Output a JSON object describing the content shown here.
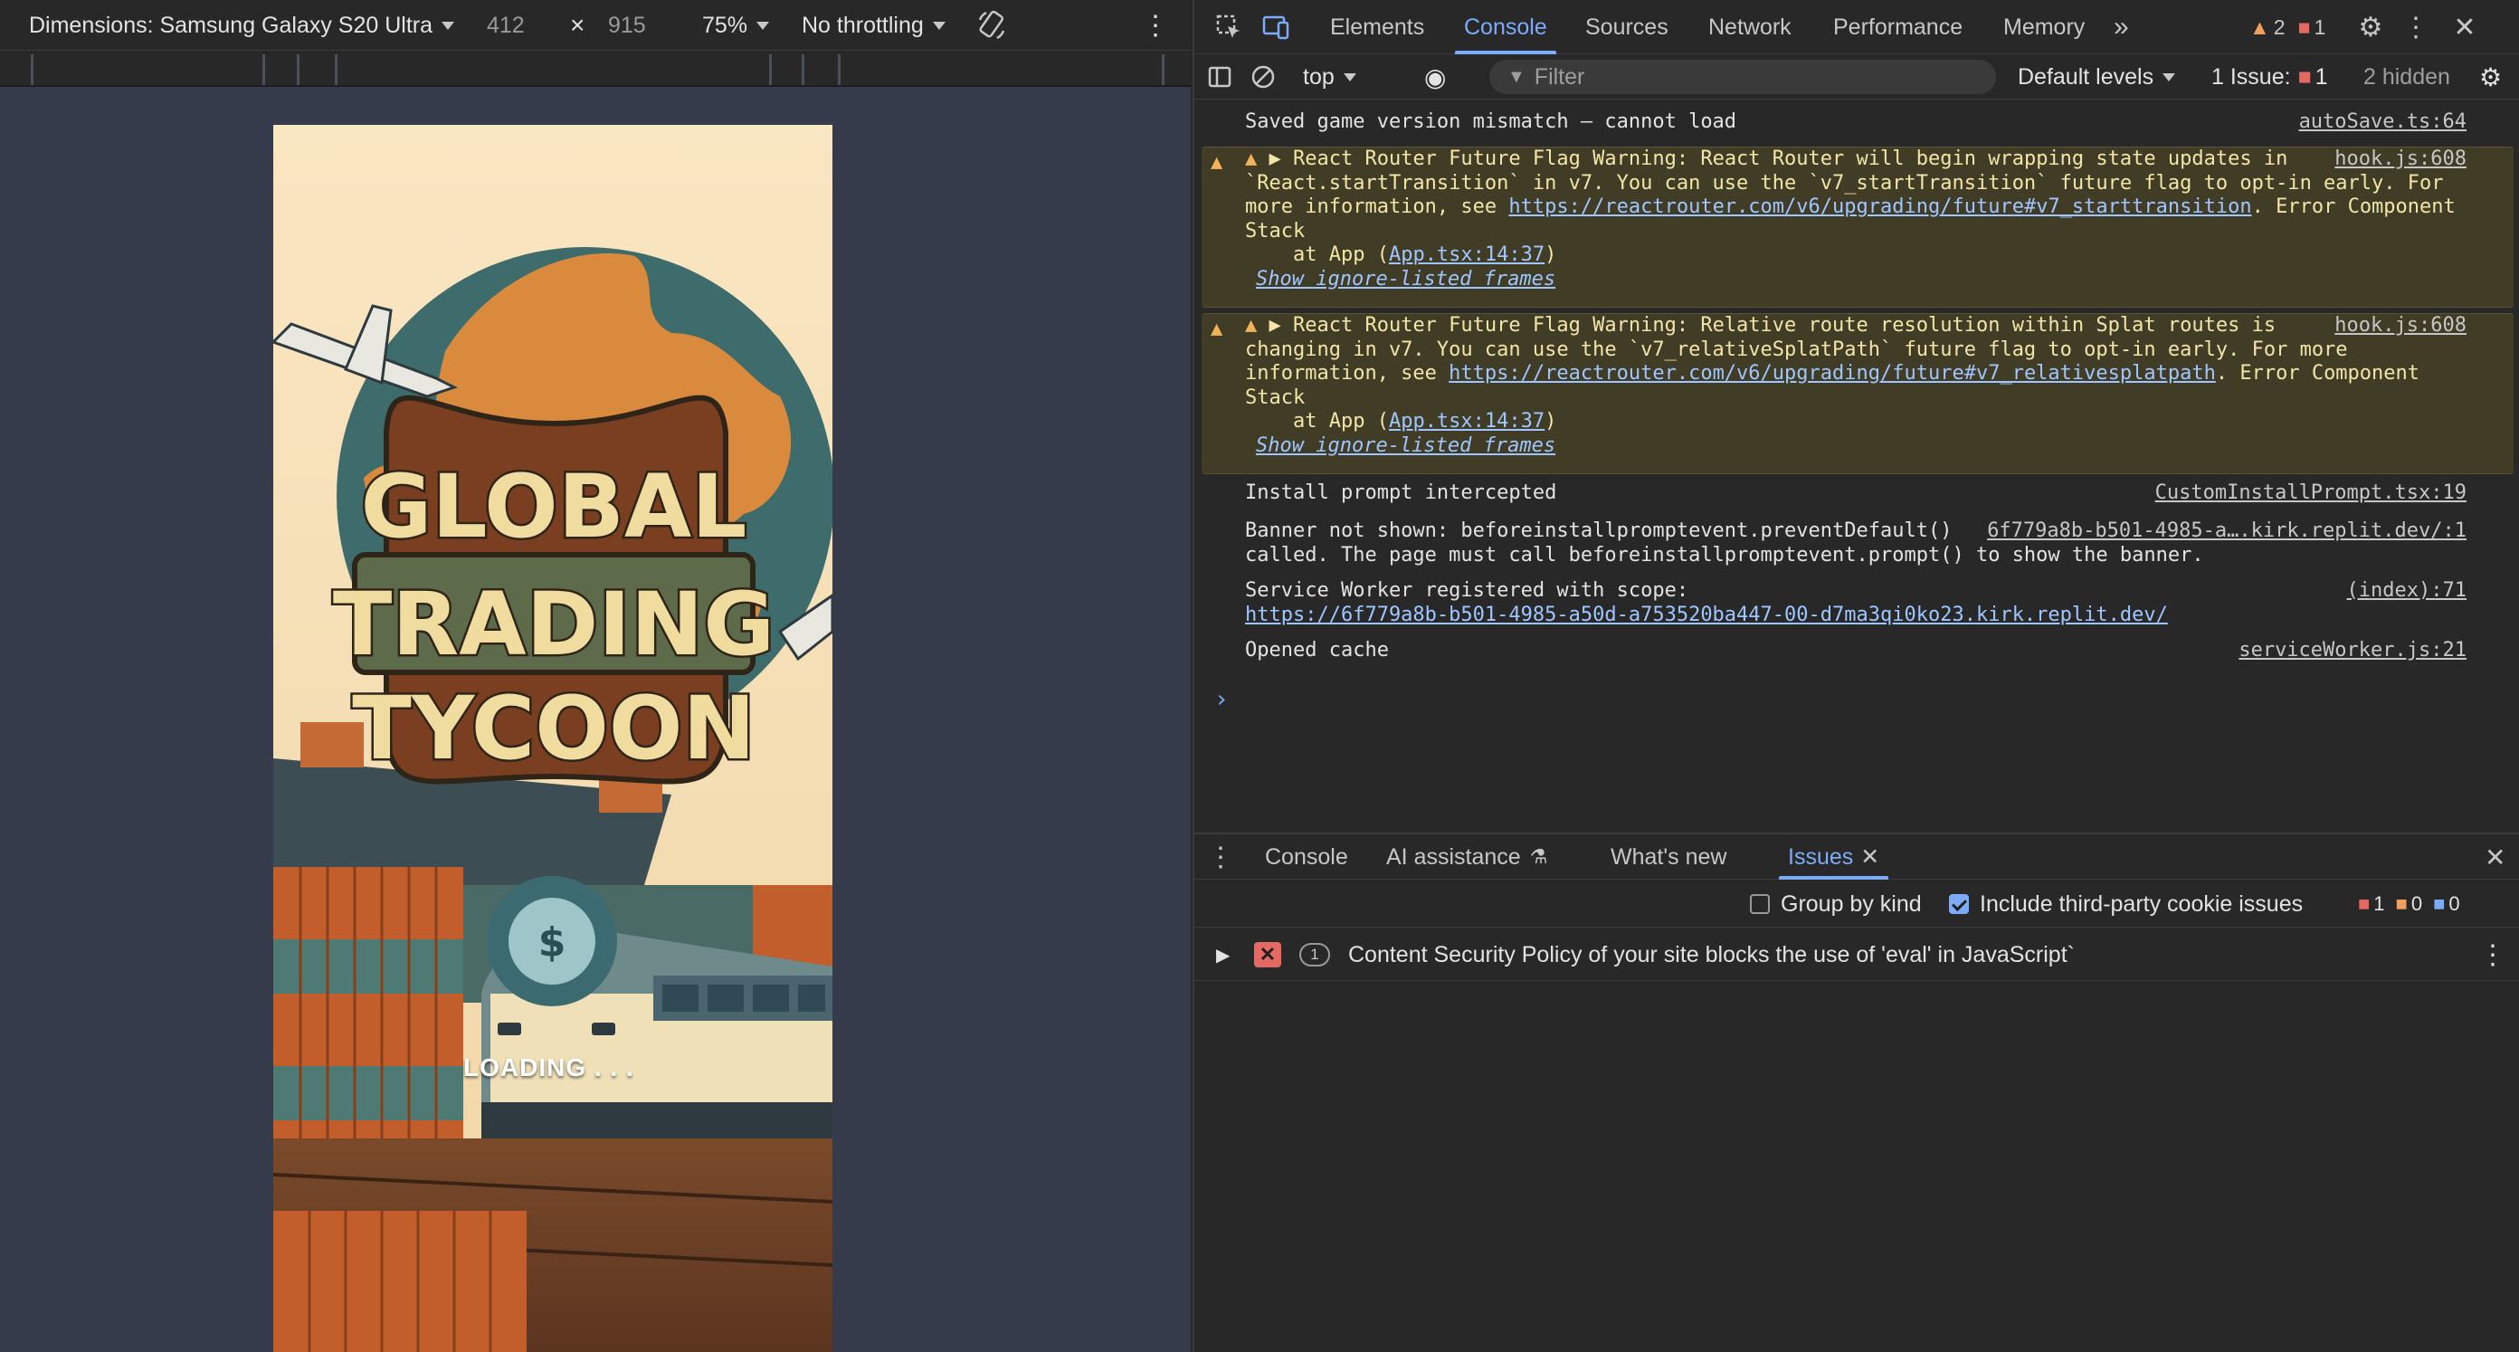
{
  "device_toolbar": {
    "dimensions_label": "Dimensions: Samsung Galaxy S20 Ultra",
    "width": "412",
    "times": "×",
    "height": "915",
    "zoom": "75%",
    "throttling": "No throttling",
    "rotate_icon": "rotate-icon",
    "more_icon": "kebab-menu-icon"
  },
  "game": {
    "title_line1": "GLOBAL",
    "title_line2": "TRADING",
    "title_line3": "TYCOON",
    "coin_symbol": "$",
    "loading_text": "LOADING . . ."
  },
  "devtools": {
    "tabs": [
      "Elements",
      "Console",
      "Sources",
      "Network",
      "Performance",
      "Memory"
    ],
    "active_tab": "Console",
    "more_tabs": "»",
    "warning_count": "2",
    "error_count": "1",
    "console_toolbar": {
      "context": "top",
      "filter_placeholder": "Filter",
      "levels": "Default levels",
      "issues_label": "1 Issue:",
      "issues_count": "1",
      "hidden": "2 hidden"
    },
    "messages": [
      {
        "text": "Saved game version mismatch – cannot load",
        "source": "autoSave.ts:64"
      },
      {
        "line1": "▶ React Router Future Flag Warning: React Router will begin wrapping state updates in",
        "line2": "`React.startTransition` in v7. You can use the `v7_startTransition` future flag to opt-in early. For",
        "line3_pre": "more information, see ",
        "line3_link": "https://reactrouter.com/v6/upgrading/future#v7_starttransition",
        "line3_post": ". Error Component",
        "line4": "Stack",
        "at_pre": "    at App (",
        "at_link": "App.tsx:14:37",
        "at_post": ")",
        "ignore": "Show ignore-listed frames",
        "source": "hook.js:608"
      },
      {
        "line1": "▶ React Router Future Flag Warning: Relative route resolution within Splat routes is",
        "line2": "changing in v7. You can use the `v7_relativeSplatPath` future flag to opt-in early. For more",
        "line3_pre": "information, see ",
        "line3_link": "https://reactrouter.com/v6/upgrading/future#v7_relativesplatpath",
        "line3_post": ". Error Component",
        "line4": "Stack",
        "at_pre": "    at App (",
        "at_link": "App.tsx:14:37",
        "at_post": ")",
        "ignore": "Show ignore-listed frames",
        "source": "hook.js:608"
      },
      {
        "text": "Install prompt intercepted",
        "source": "CustomInstallPrompt.tsx:19"
      },
      {
        "line1": "Banner not shown: beforeinstallpromptevent.preventDefault()",
        "line2": "called. The page must call beforeinstallpromptevent.prompt() to show the banner.",
        "source": "6f779a8b-b501-4985-a….kirk.replit.dev/:1"
      },
      {
        "line1": "Service Worker registered with scope:",
        "link": "https://6f779a8b-b501-4985-a50d-a753520ba447-00-d7ma3qi0ko23.kirk.replit.dev/",
        "source": "(index):71"
      },
      {
        "text": "Opened cache",
        "source": "serviceWorker.js:21"
      }
    ],
    "prompt": "›",
    "drawer": {
      "tabs": [
        "Console",
        "AI assistance",
        "What's new",
        "Issues"
      ],
      "active_tab": "Issues",
      "group_by_kind": "Group by kind",
      "include_third_party": "Include third-party cookie issues",
      "counts": {
        "errors": "1",
        "warnings": "0",
        "infos": "0"
      },
      "issue": {
        "count": "1",
        "title": "Content Security Policy of your site blocks the use of 'eval' in JavaScript`"
      }
    }
  },
  "colors": {
    "accent": "#7cacf8",
    "warning_bg": "#413c26",
    "error": "#e46962"
  }
}
